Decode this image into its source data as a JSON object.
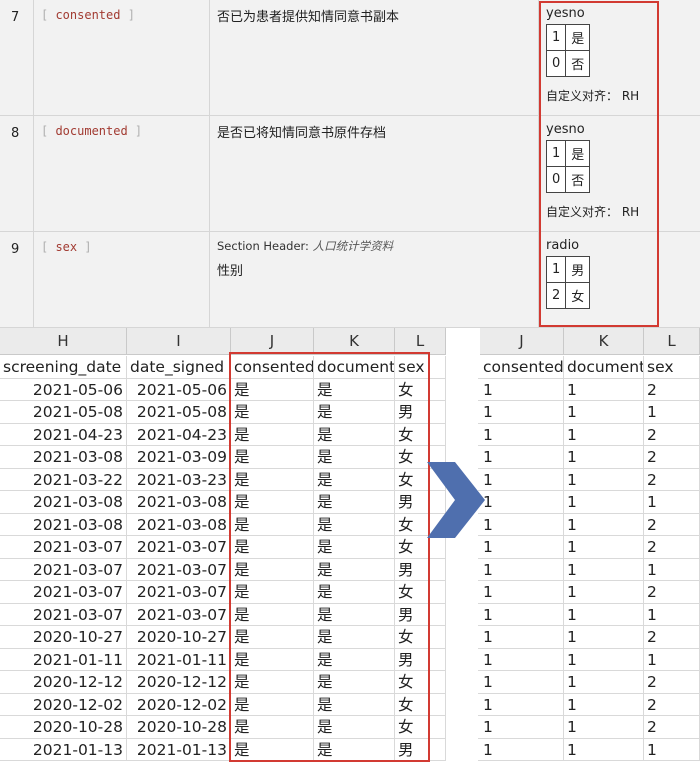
{
  "codebook": {
    "rows": [
      {
        "num": "7",
        "var_prefix": "[ ",
        "var": "consented",
        "var_suffix": " ]",
        "section_header": "",
        "header_value": "",
        "label": "否已为患者提供知情同意书副本",
        "type": "yesno",
        "choices": [
          [
            "1",
            "是"
          ],
          [
            "0",
            "否"
          ]
        ],
        "align": "自定义对齐： RH"
      },
      {
        "num": "8",
        "var_prefix": "[ ",
        "var": "documented",
        "var_suffix": " ]",
        "section_header": "",
        "header_value": "",
        "label": "是否已将知情同意书原件存档",
        "type": "yesno",
        "choices": [
          [
            "1",
            "是"
          ],
          [
            "0",
            "否"
          ]
        ],
        "align": "自定义对齐： RH"
      },
      {
        "num": "9",
        "var_prefix": "[ ",
        "var": "sex",
        "var_suffix": " ]",
        "section_header": "Section Header: ",
        "header_value": "人口统计学资料",
        "label": "性别",
        "type": "radio",
        "choices": [
          [
            "1",
            "男"
          ],
          [
            "2",
            "女"
          ]
        ],
        "align": ""
      }
    ]
  },
  "sheet_left": {
    "col_letters": [
      "H",
      "I",
      "J",
      "K",
      "L"
    ],
    "headers": [
      "screening_date",
      "date_signed",
      "consented",
      "document",
      "sex"
    ],
    "rows": [
      [
        "2021-05-06",
        "2021-05-06",
        "是",
        "是",
        "女"
      ],
      [
        "2021-05-08",
        "2021-05-08",
        "是",
        "是",
        "男"
      ],
      [
        "2021-04-23",
        "2021-04-23",
        "是",
        "是",
        "女"
      ],
      [
        "2021-03-08",
        "2021-03-09",
        "是",
        "是",
        "女"
      ],
      [
        "2021-03-22",
        "2021-03-23",
        "是",
        "是",
        "女"
      ],
      [
        "2021-03-08",
        "2021-03-08",
        "是",
        "是",
        "男"
      ],
      [
        "2021-03-08",
        "2021-03-08",
        "是",
        "是",
        "女"
      ],
      [
        "2021-03-07",
        "2021-03-07",
        "是",
        "是",
        "女"
      ],
      [
        "2021-03-07",
        "2021-03-07",
        "是",
        "是",
        "男"
      ],
      [
        "2021-03-07",
        "2021-03-07",
        "是",
        "是",
        "女"
      ],
      [
        "2021-03-07",
        "2021-03-07",
        "是",
        "是",
        "男"
      ],
      [
        "2020-10-27",
        "2020-10-27",
        "是",
        "是",
        "女"
      ],
      [
        "2021-01-11",
        "2021-01-11",
        "是",
        "是",
        "男"
      ],
      [
        "2020-12-12",
        "2020-12-12",
        "是",
        "是",
        "女"
      ],
      [
        "2020-12-02",
        "2020-12-02",
        "是",
        "是",
        "女"
      ],
      [
        "2020-10-28",
        "2020-10-28",
        "是",
        "是",
        "女"
      ],
      [
        "2021-01-13",
        "2021-01-13",
        "是",
        "是",
        "男"
      ]
    ]
  },
  "sheet_right": {
    "col_letters": [
      "J",
      "K",
      "L"
    ],
    "headers": [
      "consented",
      "document",
      "sex"
    ],
    "rows": [
      [
        "1",
        "1",
        "2"
      ],
      [
        "1",
        "1",
        "1"
      ],
      [
        "1",
        "1",
        "2"
      ],
      [
        "1",
        "1",
        "2"
      ],
      [
        "1",
        "1",
        "2"
      ],
      [
        "1",
        "1",
        "1"
      ],
      [
        "1",
        "1",
        "2"
      ],
      [
        "1",
        "1",
        "2"
      ],
      [
        "1",
        "1",
        "1"
      ],
      [
        "1",
        "1",
        "2"
      ],
      [
        "1",
        "1",
        "1"
      ],
      [
        "1",
        "1",
        "2"
      ],
      [
        "1",
        "1",
        "1"
      ],
      [
        "1",
        "1",
        "2"
      ],
      [
        "1",
        "1",
        "2"
      ],
      [
        "1",
        "1",
        "2"
      ],
      [
        "1",
        "1",
        "1"
      ]
    ]
  },
  "colors": {
    "highlight": "#d23a32",
    "arrow": "#4f6fae",
    "var_name": "#a23b32"
  },
  "icons": {
    "arrow": "chevron-right-arrow-icon"
  }
}
